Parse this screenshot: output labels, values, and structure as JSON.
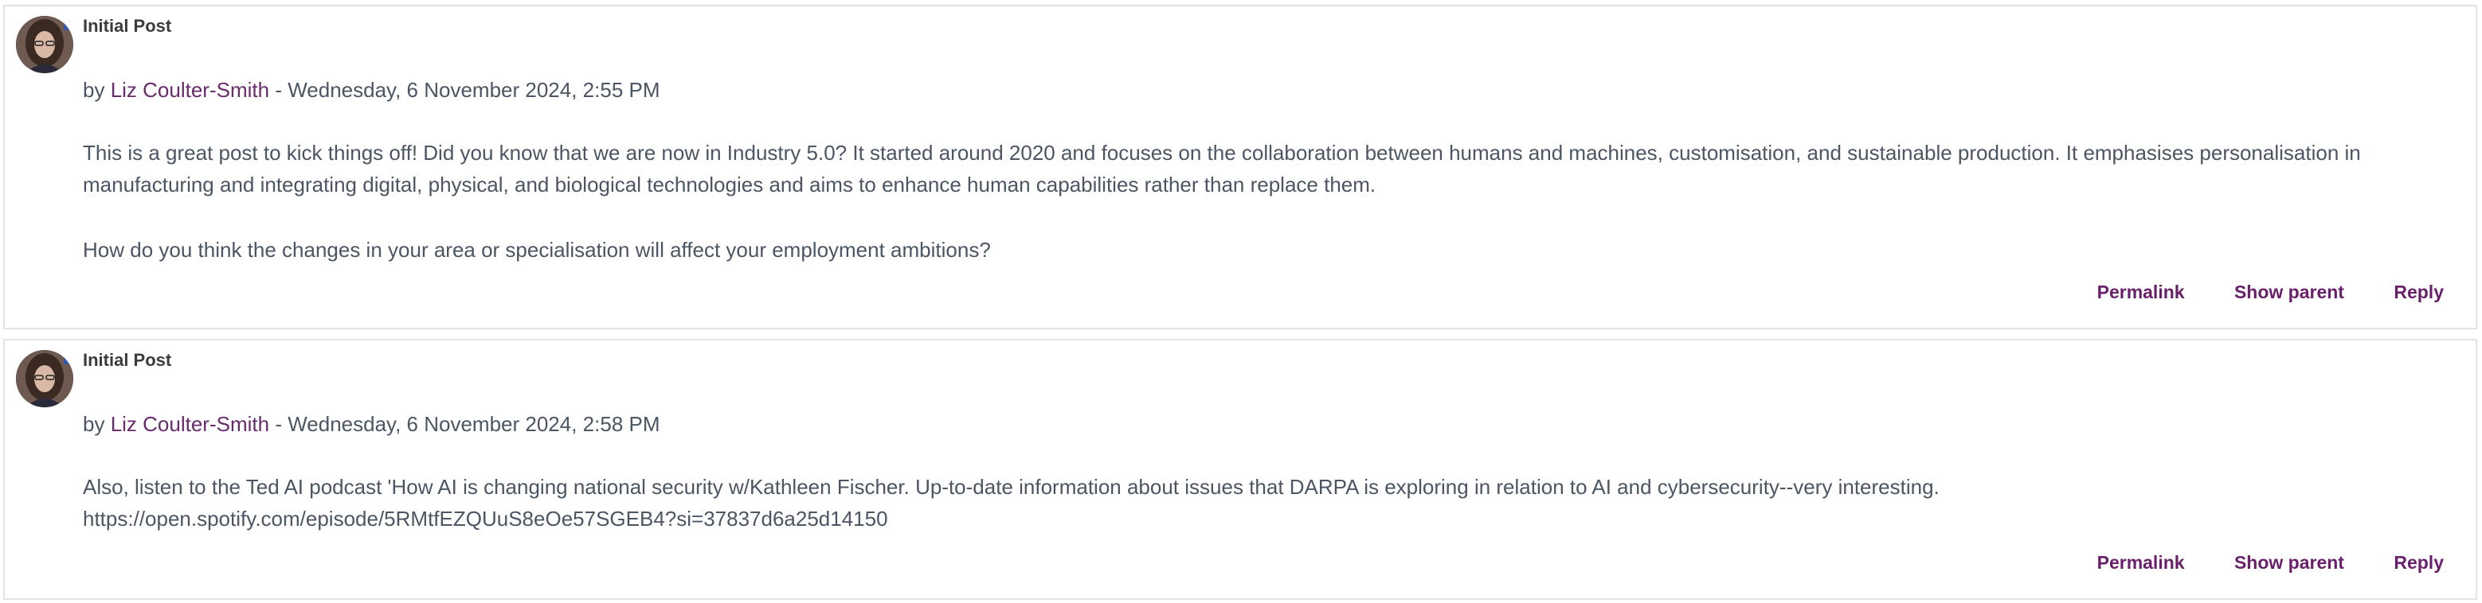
{
  "posts": [
    {
      "title": "Initial Post",
      "by_prefix": "by ",
      "author": "Liz Coulter-Smith",
      "date": " - Wednesday, 6 November 2024, 2:55 PM",
      "paragraphs": [
        "This is a great post to kick things off! Did you know that we are now in Industry 5.0? It started around 2020 and focuses on the collaboration between humans and machines, customisation, and sustainable production. It emphasises personalisation in manufacturing and integrating digital, physical, and biological technologies and aims to enhance human capabilities rather than replace them.",
        "How do you think the changes in your area or specialisation will affect your employment ambitions?"
      ],
      "actions": {
        "permalink": "Permalink",
        "show_parent": "Show parent",
        "reply": "Reply"
      }
    },
    {
      "title": "Initial Post",
      "by_prefix": "by ",
      "author": "Liz Coulter-Smith",
      "date": " - Wednesday, 6 November 2024, 2:58 PM",
      "paragraphs": [
        "Also, listen to the Ted AI podcast 'How AI is changing national security w/Kathleen Fischer. Up-to-date information about issues that DARPA is exploring in relation to AI and cybersecurity--very interesting.",
        "https://open.spotify.com/episode/5RMtfEZQUuS8eOe57SGEB4?si=37837d6a25d14150"
      ],
      "actions": {
        "permalink": "Permalink",
        "show_parent": "Show parent",
        "reply": "Reply"
      }
    }
  ],
  "icons": {
    "avatar": "user-avatar-photo"
  },
  "colors": {
    "link": "#6a2a6e",
    "action": "#6a1f6b",
    "border": "#e2e2e2",
    "text": "#4b5563"
  }
}
